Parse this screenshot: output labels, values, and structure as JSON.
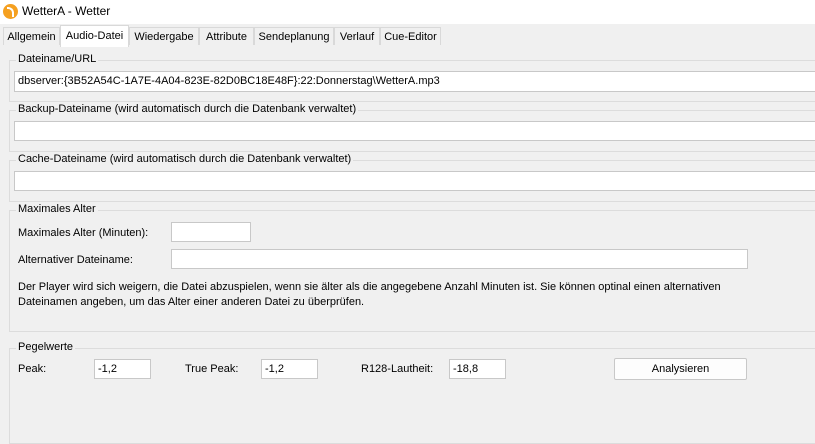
{
  "window": {
    "title": "WetterA - Wetter",
    "icon": "app-logo-icon"
  },
  "tabs": [
    "Allgemein",
    "Audio-Datei",
    "Wiedergabe",
    "Attribute",
    "Sendeplanung",
    "Verlauf",
    "Cue-Editor"
  ],
  "active_tab": "Audio-Datei",
  "filename": {
    "label": "Dateiname/URL",
    "value": "dbserver:{3B52A54C-1A7E-4A04-823E-82D0BC18E48F}:22:Donnerstag\\WetterA.mp3"
  },
  "backup": {
    "label": "Backup-Dateiname (wird automatisch durch die Datenbank verwaltet)",
    "value": ""
  },
  "cache": {
    "label": "Cache-Dateiname (wird automatisch durch die Datenbank verwaltet)",
    "value": ""
  },
  "max_age": {
    "group_label": "Maximales Alter",
    "minutes_label": "Maximales Alter (Minuten):",
    "minutes_value": "",
    "alt_label": "Alternativer Dateiname:",
    "alt_value": "",
    "description_line1": "Der Player wird sich weigern, die Datei abzuspielen, wenn sie älter als die angegebene Anzahl Minuten ist. Sie können optinal einen alternativen",
    "description_line2": "Dateinamen angeben, um das Alter einer anderen Datei zu überprüfen."
  },
  "levels": {
    "group_label": "Pegelwerte",
    "peak_label": "Peak:",
    "peak_value": "-1,2",
    "true_peak_label": "True Peak:",
    "true_peak_value": "-1,2",
    "loudness_label": "R128-Lautheit:",
    "loudness_value": "-18,8",
    "analyze_button": "Analysieren"
  }
}
